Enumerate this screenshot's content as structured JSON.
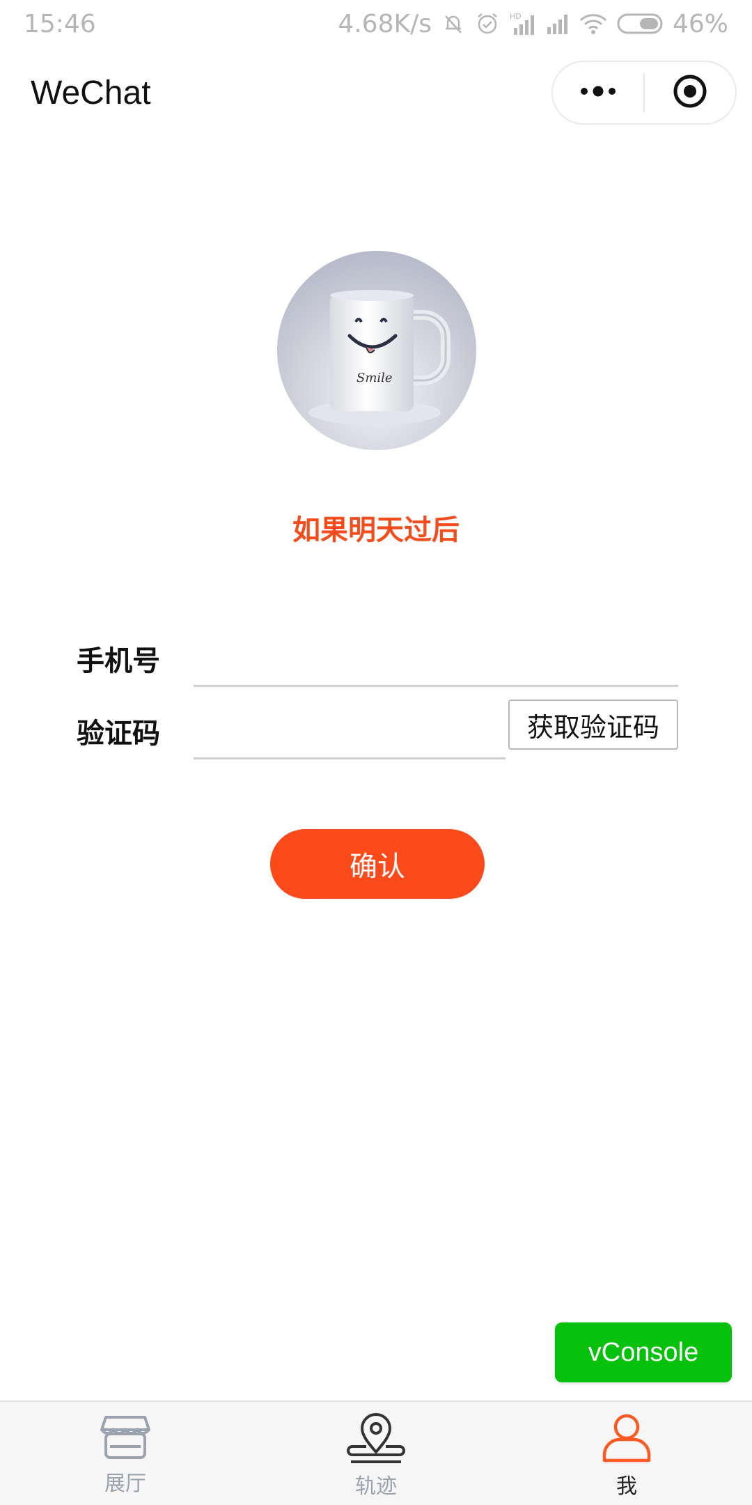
{
  "status_bar": {
    "time": "15:46",
    "network_speed": "4.68K/s",
    "battery": "46%",
    "icons": [
      "mute-icon",
      "alarm-icon",
      "hd-signal-icon",
      "signal-icon",
      "wifi-icon",
      "battery-icon"
    ]
  },
  "nav": {
    "title": "WeChat",
    "more_icon": "more-dots-icon",
    "close_icon": "target-icon"
  },
  "profile": {
    "avatar": "smile-mug-avatar",
    "username": "如果明天过后"
  },
  "form": {
    "phone_label": "手机号",
    "phone_value": "",
    "code_label": "验证码",
    "code_value": "",
    "get_code_label": "获取验证码"
  },
  "confirm_label": "确认",
  "vconsole_label": "vConsole",
  "tabs": [
    {
      "label": "展厅",
      "icon": "store-icon",
      "active": false
    },
    {
      "label": "轨迹",
      "icon": "location-pin-icon",
      "active": false
    },
    {
      "label": "我",
      "icon": "user-icon",
      "active": true
    }
  ],
  "colors": {
    "accent": "#fd4a1b",
    "username": "#f44c1c",
    "vconsole": "#05c10c",
    "tab_inactive": "#9aa3ad"
  }
}
